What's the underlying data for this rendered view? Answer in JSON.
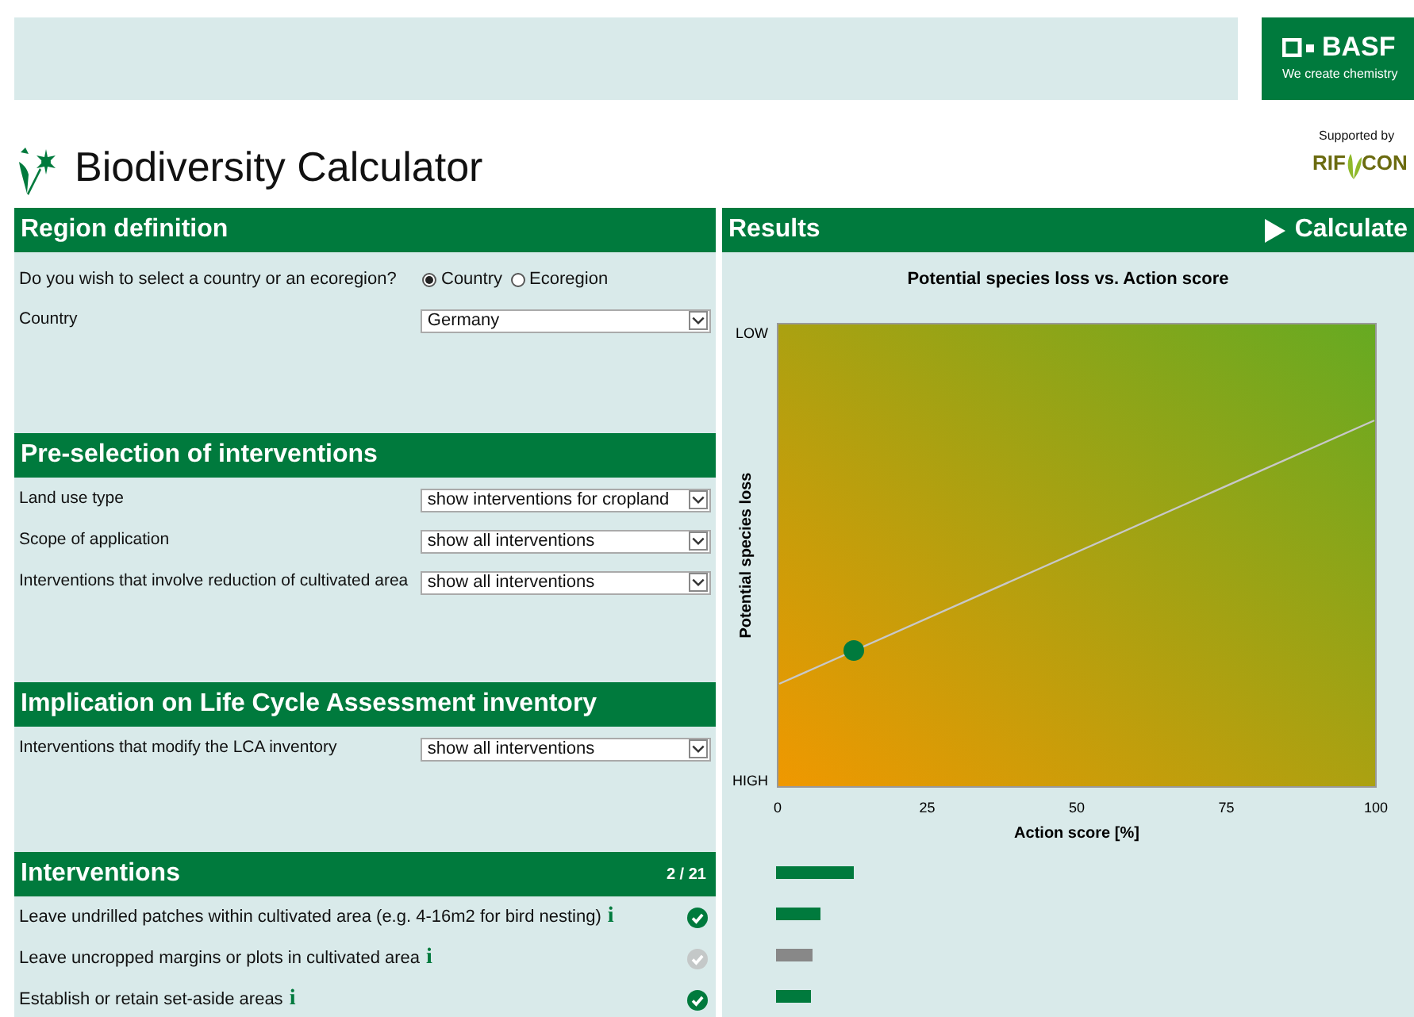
{
  "brand": {
    "logo_text": "BASF",
    "tagline": "We create chemistry",
    "supporter_label": "Supported by",
    "supporter_logo_left": "RIF",
    "supporter_logo_right": "CON"
  },
  "title": "Biodiversity Calculator",
  "region": {
    "header": "Region definition",
    "question": "Do you wish to select a country or an ecoregion?",
    "options": [
      {
        "label": "Country",
        "selected": true
      },
      {
        "label": "Ecoregion",
        "selected": false
      }
    ],
    "country_label": "Country",
    "country_value": "Germany"
  },
  "preselection": {
    "header": "Pre-selection of interventions",
    "rows": [
      {
        "label": "Land use type",
        "value": "show interventions for cropland"
      },
      {
        "label": "Scope of application",
        "value": "show all interventions"
      },
      {
        "label": "Interventions that involve reduction of cultivated area",
        "value": "show all interventions"
      }
    ]
  },
  "lca": {
    "header": "Implication on Life Cycle Assessment inventory",
    "rows": [
      {
        "label": "Interventions that modify the LCA inventory",
        "value": "show all interventions"
      }
    ]
  },
  "interventions": {
    "header": "Interventions",
    "count": "2 / 21",
    "summary_bar": {
      "level": 0.13
    },
    "items": [
      {
        "label": "Leave undrilled patches within cultivated area (e.g. 4-16m2 for bird nesting)",
        "info": "i",
        "checked": true,
        "level": 0.074
      },
      {
        "label": "Leave uncropped margins or plots in cultivated area",
        "info": "i",
        "checked": false,
        "level": 0.061
      },
      {
        "label": "Establish or retain set-aside areas",
        "info": "i",
        "checked": true,
        "level": 0.058
      }
    ]
  },
  "results": {
    "header": "Results",
    "calculate": "Calculate",
    "chart": {
      "title": "Potential species loss vs. Action score",
      "y_axis_title": "Potential species loss",
      "y_top_label": "LOW",
      "y_bottom_label": "HIGH",
      "x_ticks": [
        "0",
        "25",
        "50",
        "75",
        "100"
      ],
      "x_axis_title": "Action score [%]"
    }
  }
}
